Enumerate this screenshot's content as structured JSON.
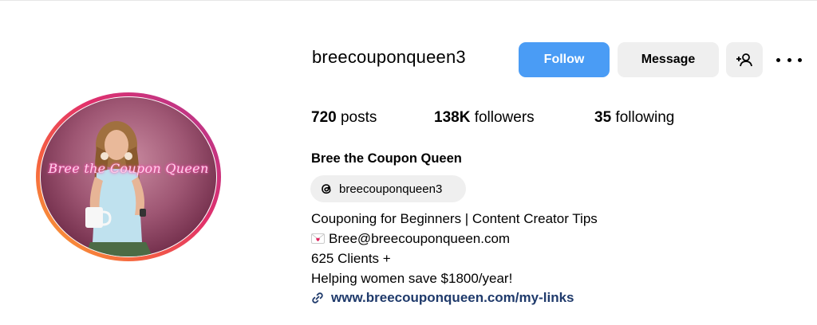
{
  "profile": {
    "username": "breecouponqueen3",
    "follow_label": "Follow",
    "message_label": "Message",
    "avatar_text": "Bree the Coupon Queen",
    "stats": {
      "posts_count": "720",
      "posts_label": "posts",
      "followers_count": "138K",
      "followers_label": "followers",
      "following_count": "35",
      "following_label": "following"
    },
    "full_name": "Bree the Coupon Queen",
    "threads_handle": "breecouponqueen3",
    "bio": {
      "line1": "Couponing for Beginners | Content Creator Tips",
      "email": "Bree@breecouponqueen.com",
      "line3": "625 Clients +",
      "line4": "Helping women save $1800/year!"
    },
    "link": "www.breecouponqueen.com/my-links"
  },
  "icons": {
    "add_user": "add-user-icon",
    "more": "more-options-icon",
    "threads": "threads-icon",
    "email": "love-letter-icon",
    "link": "link-icon"
  },
  "colors": {
    "follow_button": "#4a9cf5",
    "secondary_button": "#efefef",
    "link_text": "#1f3a6b"
  }
}
